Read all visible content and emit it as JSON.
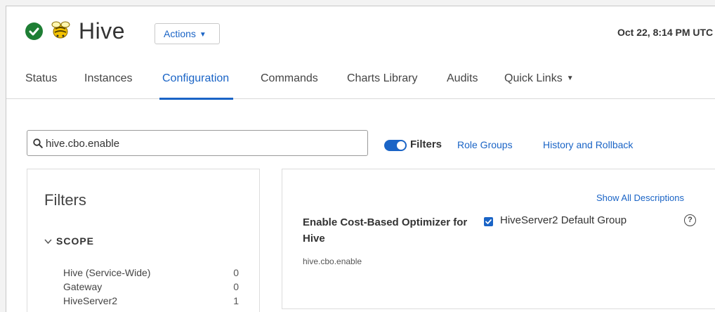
{
  "header": {
    "service_name": "Hive",
    "actions_label": "Actions",
    "timestamp": "Oct 22, 8:14 PM UTC",
    "status_icon": "check-circle-icon",
    "logo_icon": "hive-bee-logo"
  },
  "tabs": [
    {
      "label": "Status"
    },
    {
      "label": "Instances"
    },
    {
      "label": "Configuration",
      "active": true
    },
    {
      "label": "Commands"
    },
    {
      "label": "Charts Library"
    },
    {
      "label": "Audits"
    },
    {
      "label": "Quick Links",
      "has_dropdown": true
    }
  ],
  "search": {
    "value": "hive.cbo.enable"
  },
  "toolbar": {
    "filters_toggle_label": "Filters",
    "filters_toggle_on": true,
    "role_groups_label": "Role Groups",
    "history_label": "History and Rollback"
  },
  "filters_panel": {
    "title": "Filters",
    "scope_label": "SCOPE",
    "scope_items": [
      {
        "label": "Hive (Service-Wide)",
        "count": "0"
      },
      {
        "label": "Gateway",
        "count": "0"
      },
      {
        "label": "HiveServer2",
        "count": "1"
      }
    ]
  },
  "config": {
    "show_all_descriptions": "Show All Descriptions",
    "property_display_name": "Enable Cost-Based Optimizer for Hive",
    "property_key": "hive.cbo.enable",
    "group_label": "HiveServer2 Default Group",
    "group_checked": true,
    "help_icon": "question-circle-icon"
  },
  "colors": {
    "accent": "#1a64c6",
    "status_ok": "#1e7e34"
  }
}
